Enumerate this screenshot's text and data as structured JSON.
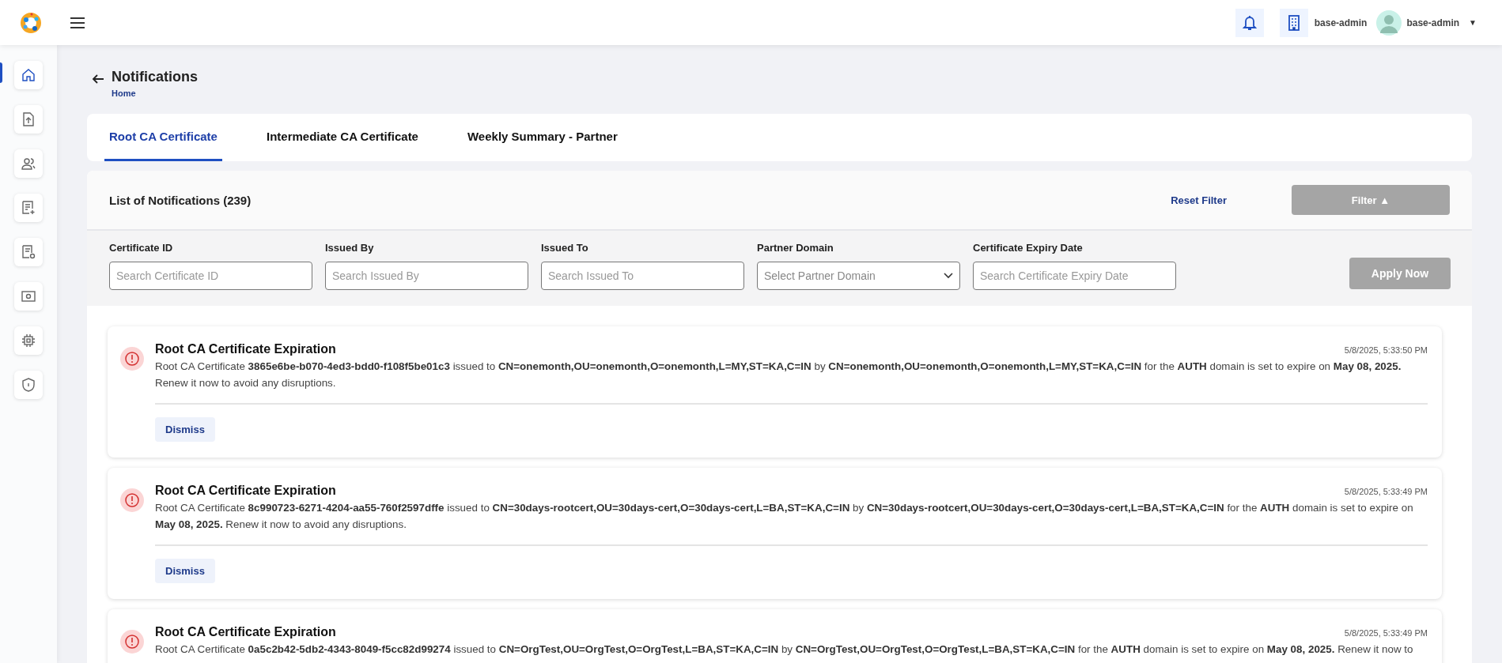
{
  "header": {
    "tenant": "base-admin",
    "user": "base-admin",
    "user_menu_caret": "▼"
  },
  "sidebar": {
    "items": [
      {
        "selected": true
      },
      {
        "selected": false
      },
      {
        "selected": false
      },
      {
        "selected": false
      },
      {
        "selected": false
      },
      {
        "selected": false
      },
      {
        "selected": false
      },
      {
        "selected": false
      }
    ]
  },
  "page": {
    "title": "Notifications",
    "breadcrumb": "Home"
  },
  "tabs": [
    {
      "label": "Root CA Certificate",
      "selected": true
    },
    {
      "label": "Intermediate CA Certificate",
      "selected": false
    },
    {
      "label": "Weekly Summary - Partner",
      "selected": false
    }
  ],
  "list": {
    "title": "List of Notifications (239)",
    "reset": "Reset Filter",
    "filter_button": "Filter ▲"
  },
  "filters": [
    {
      "label": "Certificate ID",
      "kind": "input",
      "placeholder": "Search Certificate ID"
    },
    {
      "label": "Issued By",
      "kind": "input",
      "placeholder": "Search Issued By"
    },
    {
      "label": "Issued To",
      "kind": "input",
      "placeholder": "Search Issued To"
    },
    {
      "label": "Partner Domain",
      "kind": "select",
      "placeholder": "Select Partner Domain"
    },
    {
      "label": "Certificate Expiry Date",
      "kind": "input",
      "placeholder": "Search Certificate Expiry Date"
    }
  ],
  "apply_button": "Apply Now",
  "notifications": [
    {
      "title": "Root CA Certificate Expiration",
      "time": "5/8/2025, 5:33:50 PM",
      "message": "Root CA Certificate **3865e6be-b070-4ed3-bdd0-f108f5be01c3** issued to **CN=onemonth,OU=onemonth,O=onemonth,L=MY,ST=KA,C=IN** by **CN=onemonth,OU=onemonth,O=onemonth,L=MY,ST=KA,C=IN** for the **AUTH** domain is set to expire on **May 08, 2025.** Renew it now to avoid any disruptions.",
      "action": "Dismiss"
    },
    {
      "title": "Root CA Certificate Expiration",
      "time": "5/8/2025, 5:33:49 PM",
      "message": "Root CA Certificate **8c990723-6271-4204-aa55-760f2597dffe** issued to **CN=30days-rootcert,OU=30days-cert,O=30days-cert,L=BA,ST=KA,C=IN** by **CN=30days-rootcert,OU=30days-cert,O=30days-cert,L=BA,ST=KA,C=IN** for the **AUTH** domain is set to expire on **May 08, 2025.** Renew it now to avoid any disruptions.",
      "action": "Dismiss"
    },
    {
      "title": "Root CA Certificate Expiration",
      "time": "5/8/2025, 5:33:49 PM",
      "message": "Root CA Certificate **0a5c2b42-5db2-4343-8049-f5cc82d99274** issued to **CN=OrgTest,OU=OrgTest,O=OrgTest,L=BA,ST=KA,C=IN** by **CN=OrgTest,OU=OrgTest,O=OrgTest,L=BA,ST=KA,C=IN** for the **AUTH** domain is set to expire on **May 08, 2025.** Renew it now to"
    }
  ]
}
